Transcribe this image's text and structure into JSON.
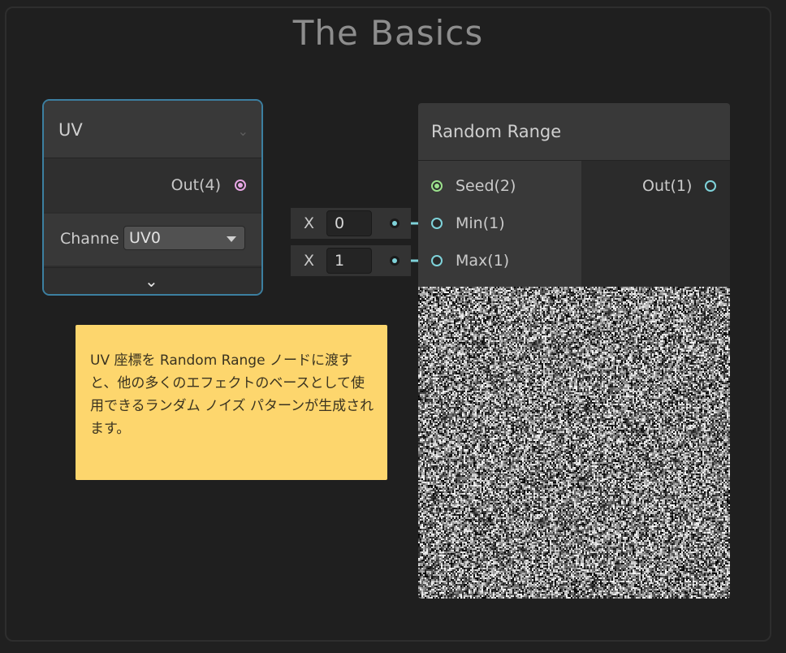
{
  "group": {
    "title": "The Basics"
  },
  "uv_node": {
    "title": "UV",
    "collapse_icon": "chevron-down-icon",
    "output_label": "Out(4)",
    "channel_label": "Channe",
    "channel_value": "UV0",
    "expand_icon": "chevron-down-icon"
  },
  "inline_inputs": [
    {
      "axis": "X",
      "value": "0"
    },
    {
      "axis": "X",
      "value": "1"
    }
  ],
  "random_range_node": {
    "title": "Random Range",
    "inputs": [
      "Seed(2)",
      "Min(1)",
      "Max(1)"
    ],
    "output": "Out(1)",
    "preview": "random-noise-preview"
  },
  "sticky_note": {
    "text": "UV 座標を Random Range ノードに渡すと、他の多くのエフェクトのベースとして使用できるランダム ノイズ パターンが生成されます。"
  },
  "colors": {
    "vector4_port": "#e7a6e4",
    "vector2_port": "#9be08c",
    "float_port": "#7fd3da",
    "selection_outline": "#3c7fa0",
    "sticky_bg": "#fdd66d"
  }
}
